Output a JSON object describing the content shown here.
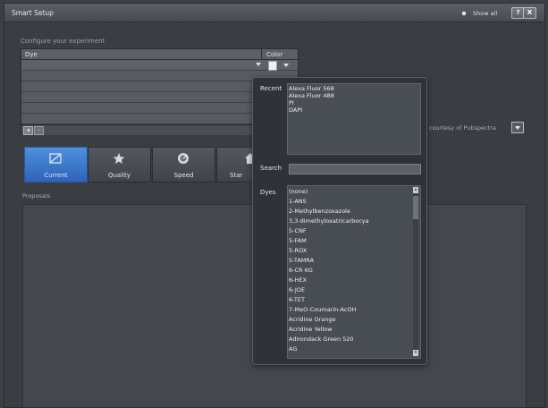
{
  "window": {
    "title": "Smart Setup",
    "show_all_label": "Show all",
    "help_label": "?",
    "close_label": "X"
  },
  "configure": {
    "section_label": "Configure your experiment",
    "dye_header": "Dye",
    "color_header": "Color"
  },
  "credit": {
    "text": "courtesy of Pubspectra"
  },
  "mode_tabs": [
    {
      "label": "Current",
      "icon": "rectangle-slash-icon"
    },
    {
      "label": "Quality",
      "icon": "star-icon"
    },
    {
      "label": "Speed",
      "icon": "speedometer-icon"
    },
    {
      "label": "Star",
      "icon": "home-icon"
    }
  ],
  "proposals": {
    "label": "Proposals"
  },
  "dye_popup": {
    "recent_label": "Recent",
    "recent_items": [
      "Alexa Fluor 568",
      "Alexa Fluor 488",
      "PI",
      "DAPI"
    ],
    "search_label": "Search",
    "search_value": "",
    "dyes_label": "Dyes",
    "dyes": [
      "(none)",
      "1-ANS",
      "2-Methylbenzoxazole",
      "3,3-dimethyloxatricarbocya",
      "5-CNF",
      "5-FAM",
      "5-ROX",
      "5-TAMRA",
      "6-CR 6G",
      "6-HEX",
      "6-JOE",
      "6-TET",
      "7-MeO-Coumarin-AcOH",
      "Acridine Orange",
      "Acridine Yellow",
      "Adirondack Green 520",
      "AG"
    ]
  },
  "colors": {
    "accent": "#3b78cf",
    "panel": "#44484e",
    "popup_bg": "#2f3238"
  }
}
